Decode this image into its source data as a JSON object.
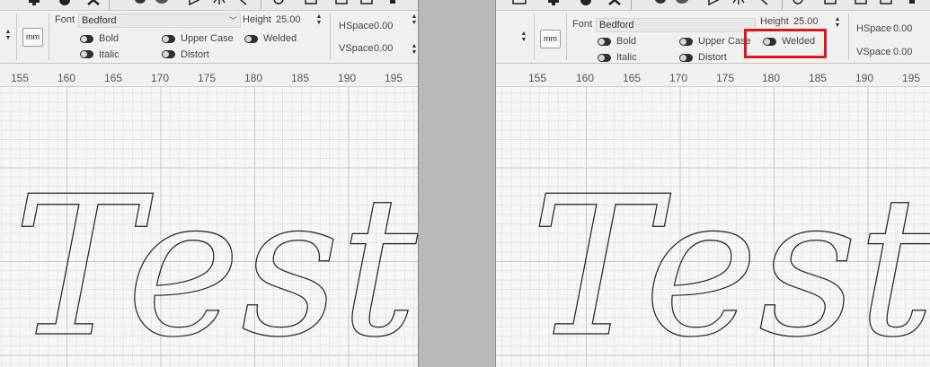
{
  "left": {
    "font_label": "Font",
    "font_value": "Bedford",
    "height_label": "Height",
    "height_value": "25.00",
    "hspace_label": "HSpace",
    "hspace_value": "0.00",
    "vspace_label": "VSpace",
    "vspace_value": "0.00",
    "unit_button": "mm",
    "toggles": {
      "bold": "Bold",
      "italic": "Italic",
      "upper_case": "Upper Case",
      "distort": "Distort",
      "welded": "Welded"
    },
    "ruler_ticks": [
      "155",
      "160",
      "165",
      "170",
      "175",
      "180",
      "185",
      "190",
      "195"
    ],
    "design_text": "Test"
  },
  "right": {
    "font_label": "Font",
    "font_value": "Bedford",
    "height_label": "Height",
    "height_value": "25.00",
    "hspace_label": "HSpace",
    "hspace_value": "0.00",
    "vspace_label": "VSpace",
    "vspace_value": "0.00",
    "unit_button": "mm",
    "toggles": {
      "bold": "Bold",
      "italic": "Italic",
      "upper_case": "Upper Case",
      "distort": "Distort",
      "welded": "Welded"
    },
    "ruler_ticks": [
      "155",
      "160",
      "165",
      "170",
      "175",
      "180",
      "185",
      "190",
      "195"
    ],
    "design_text": "Test"
  },
  "colors": {
    "highlight": "#e01515",
    "toggle_track": "#2f2f2f",
    "grid_major": "#c9c9c9",
    "grid_minor": "#e6e6e6"
  },
  "icons": [
    "monitor-icon",
    "user-icon",
    "gear-icon",
    "scissors-icon",
    "arrow-icon",
    "target-icon",
    "mirror-icon"
  ]
}
